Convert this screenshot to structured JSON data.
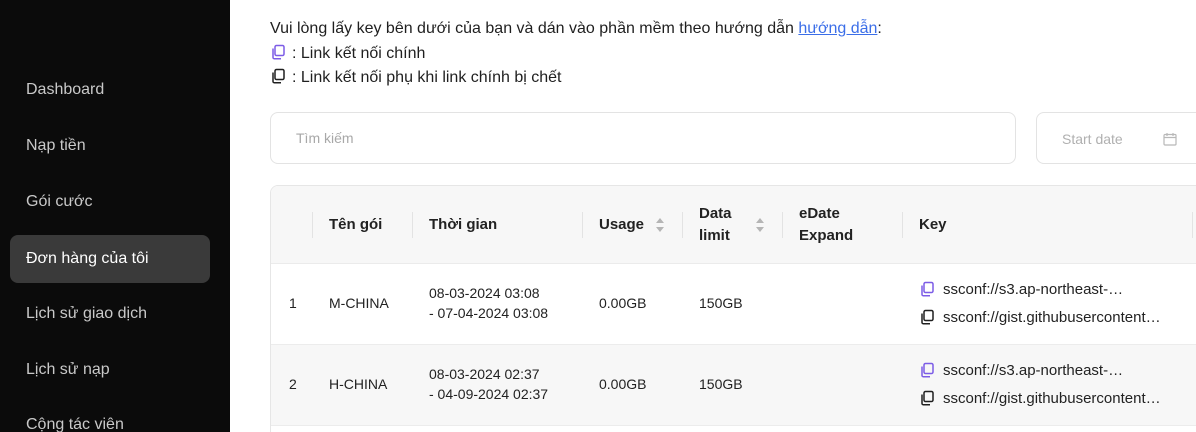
{
  "sidebar": {
    "items": [
      {
        "label": "Dashboard"
      },
      {
        "label": "Nạp tiền"
      },
      {
        "label": "Gói cước"
      },
      {
        "label": "Đơn hàng của tôi",
        "active": true
      },
      {
        "label": "Lịch sử giao dịch"
      },
      {
        "label": "Lịch sử nạp"
      },
      {
        "label": "Cộng tác viên"
      }
    ]
  },
  "instructions": {
    "line1": "Vui lòng lấy key bên dưới của bạn và dán vào phần mềm theo hướng dẫn ",
    "guide_link": "hướng dẫn",
    "line1_suffix": ":",
    "main_link_text": ": Link kết nối chính",
    "backup_link_text": ": Link kết nối phụ khi link chính bị chết"
  },
  "filters": {
    "search_placeholder": "Tìm kiếm",
    "start_date_placeholder": "Start date"
  },
  "table": {
    "columns": [
      "Tên gói",
      "Thời gian",
      "Usage",
      "Data limit",
      "eDate Expand",
      "Key"
    ],
    "rows": [
      {
        "index": "1",
        "package": "M-CHINA",
        "time_start": "08-03-2024 03:08",
        "time_end": "- 07-04-2024 03:08",
        "usage": "0.00GB",
        "data_limit": "150GB",
        "edate_expand": "",
        "key_main": "ssconf://s3.ap-northeast-…",
        "key_backup": "ssconf://gist.githubusercontent…"
      },
      {
        "index": "2",
        "package": "H-CHINA",
        "time_start": "08-03-2024 02:37",
        "time_end": "- 04-09-2024 02:37",
        "usage": "0.00GB",
        "data_limit": "150GB",
        "edate_expand": "",
        "key_main": "ssconf://s3.ap-northeast-…",
        "key_backup": "ssconf://gist.githubusercontent…"
      }
    ]
  },
  "colors": {
    "sidebar_bg": "#0b0b0b",
    "active_item_bg": "#3a3a3a",
    "link": "#3b6ee8",
    "copy_main_icon": "#7c5ce6",
    "copy_backup_icon": "#1f1f1f"
  },
  "icons": {
    "copy_main": "copy-icon",
    "copy_backup": "copy-icon",
    "calendar": "calendar-icon",
    "sort": "sort-icon"
  }
}
